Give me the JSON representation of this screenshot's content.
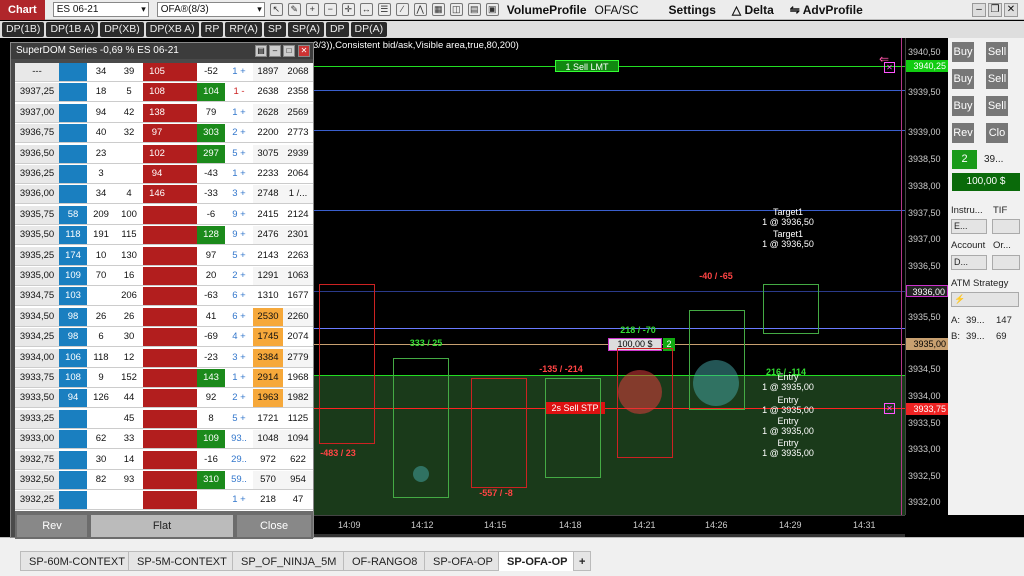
{
  "toolbar": {
    "chart_label": "Chart",
    "instrument": "ES 06-21",
    "template": "OFA®(8/3)",
    "volume_profile": "VolumeProfile",
    "ofa_sc": "OFA/SC",
    "settings": "Settings",
    "delta": "Delta",
    "advprofile": "AdvProfile"
  },
  "tabs2": [
    "DP(1B)",
    "DP(1B A)",
    "DP(XB)",
    "DP(XB A)",
    "RP",
    "RP(A)",
    "SP",
    "SP(A)",
    "DP",
    "DP(A)"
  ],
  "chart_info": "3/3)),Consistent bid/ask,Visible area,true,80,200)",
  "price_axis": [
    "3940,50",
    "3940,25",
    "3939,50",
    "3939,00",
    "3938,50",
    "3938,00",
    "3937,50",
    "3937,00",
    "3936,50",
    "3936,00",
    "3935,50",
    "3935,00",
    "3934,50",
    "3934,00",
    "3933,75",
    "3933,50",
    "3933,00",
    "3932,50",
    "3932,00"
  ],
  "time_axis": [
    "14:09",
    "14:12",
    "14:15",
    "14:18",
    "14:21",
    "14:26",
    "14:29",
    "14:31"
  ],
  "orders": {
    "sell_lmt": "1  Sell LMT",
    "sell_stp": "2s  Sell STP",
    "position_value": "100,00 $",
    "position_qty": "2",
    "targets": [
      "Target1",
      "1 @ 3936,50",
      "Target1",
      "1 @ 3936,50"
    ],
    "entries": [
      "Entry",
      "1 @ 3935,00",
      "Entry",
      "1 @ 3935,00",
      "Entry",
      "1 @ 3935,00",
      "Entry",
      "1 @ 3935,00"
    ]
  },
  "footprint": {
    "deltas": [
      "333 / 25",
      "-135 / -214",
      "218 / -70",
      "-40 / -65",
      "216 / -114",
      "-483 / 23",
      "-557 / -8"
    ]
  },
  "right_panel": {
    "buy": "Buy",
    "sell": "Sell",
    "rev": "Rev",
    "close": "Clo",
    "qty": "2",
    "last": "39...",
    "pnl": "100,00 $",
    "instrument_label": "Instru...",
    "tif_label": "TIF",
    "instrument_value": "E...",
    "account_label": "Account",
    "order_label": "Or...",
    "account_value": "D...",
    "atm_label": "ATM Strategy",
    "atm_value": "⚡",
    "a_label": "A:",
    "a_price": "39...",
    "a_size": "147",
    "b_label": "B:",
    "b_price": "39...",
    "b_size": "69"
  },
  "bottom_tabs": [
    "SP-60M-CONTEXT",
    "SP-5M-CONTEXT",
    "SP_OF_NINJA_5M",
    "OF-RANGO8",
    "SP-OFA-OP",
    "SP-OFA-OP"
  ],
  "dom": {
    "title": "SuperDOM Series -0,69 % ES 06-21",
    "rev": "Rev",
    "flat": "Flat",
    "close": "Close",
    "rows": [
      [
        "---",
        "",
        "34",
        "39",
        "105",
        "",
        "-52",
        "1 +",
        "1897",
        "2068"
      ],
      [
        "3937,25",
        "",
        "18",
        "5",
        "108",
        "",
        "104",
        "1 -",
        "2638",
        "2358"
      ],
      [
        "3937,00",
        "",
        "94",
        "42",
        "138",
        "",
        "79",
        "1 +",
        "2628",
        "2569"
      ],
      [
        "3936,75",
        "",
        "40",
        "32",
        "97",
        "",
        "303",
        "2 +",
        "2200",
        "2773"
      ],
      [
        "3936,50",
        "",
        "23",
        "",
        "102",
        "",
        "297",
        "5 +",
        "3075",
        "2939"
      ],
      [
        "3936,25",
        "",
        "3",
        "",
        "94",
        "",
        "-43",
        "1 +",
        "2233",
        "2064"
      ],
      [
        "3936,00",
        "",
        "34",
        "4",
        "146",
        "",
        "-33",
        "3 +",
        "2748",
        "1 /..."
      ],
      [
        "3935,75",
        "58",
        "209",
        "100",
        "",
        "",
        "-6",
        "9 +",
        "2415",
        "2124"
      ],
      [
        "3935,50",
        "118",
        "191",
        "115",
        "",
        "",
        "128",
        "9 +",
        "2476",
        "2301"
      ],
      [
        "3935,25",
        "174",
        "10",
        "130",
        "",
        "",
        "97",
        "5 +",
        "2143",
        "2263"
      ],
      [
        "3935,00",
        "109",
        "70",
        "16",
        "",
        "",
        "20",
        "2 +",
        "1291",
        "1063"
      ],
      [
        "3934,75",
        "103",
        "",
        "206",
        "",
        "",
        "-63",
        "6 +",
        "1310",
        "1677"
      ],
      [
        "3934,50",
        "98",
        "26",
        "26",
        "",
        "",
        "41",
        "6 +",
        "2530",
        "2260"
      ],
      [
        "3934,25",
        "98",
        "6",
        "30",
        "",
        "",
        "-69",
        "4 +",
        "1745",
        "2074"
      ],
      [
        "3934,00",
        "106",
        "118",
        "12",
        "",
        "",
        "-23",
        "3 +",
        "3384",
        "2779"
      ],
      [
        "3933,75",
        "108",
        "9",
        "152",
        "",
        "",
        "143",
        "1 +",
        "2914",
        "1968"
      ],
      [
        "3933,50",
        "94",
        "126",
        "44",
        "",
        "",
        "92",
        "2 +",
        "1963",
        "1982"
      ],
      [
        "3933,25",
        "",
        "",
        "45",
        "",
        "",
        "8",
        "5 +",
        "1721",
        "1125"
      ],
      [
        "3933,00",
        "",
        "62",
        "33",
        "",
        "",
        "109",
        "93..",
        "1048",
        "1094"
      ],
      [
        "3932,75",
        "",
        "30",
        "14",
        "",
        "",
        "-16",
        "29..",
        "972",
        "622"
      ],
      [
        "3932,50",
        "",
        "82",
        "93",
        "",
        "",
        "310",
        "59..",
        "570",
        "954"
      ],
      [
        "3932,25",
        "",
        "",
        "",
        "",
        "",
        "",
        "1 +",
        "218",
        "47"
      ]
    ]
  }
}
